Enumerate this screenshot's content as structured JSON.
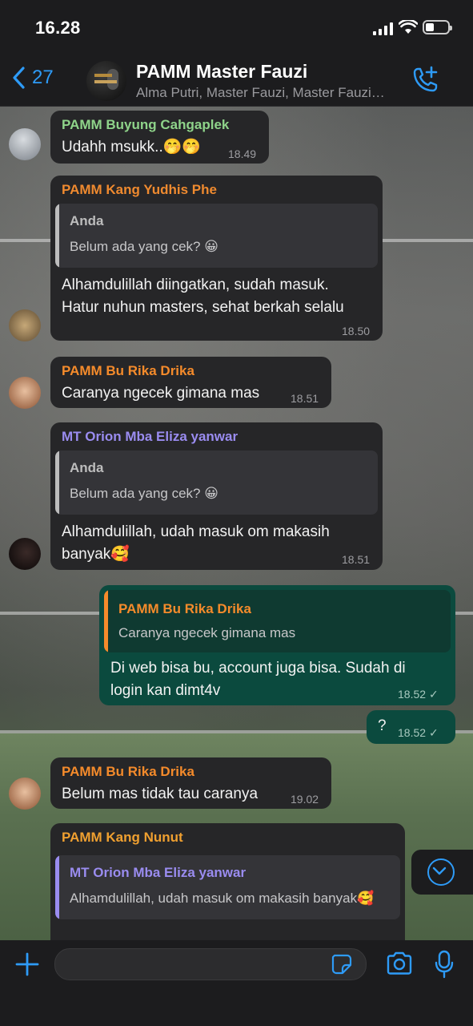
{
  "status_bar": {
    "time": "16.28"
  },
  "header": {
    "back_count": "27",
    "title": "PAMM Master Fauzi",
    "subtitle": "Alma Putri, Master Fauzi, Master Fauzi…"
  },
  "messages": [
    {
      "sender": "PAMM Buyung Cahgaplek",
      "sender_color": "#8fd48a",
      "lines": [
        "Udahh msukk..🤭🤭"
      ],
      "time": "18.49"
    },
    {
      "sender": "PAMM Kang Yudhis Phe",
      "sender_color": "#ef8a2f",
      "quote": {
        "name": "Anda",
        "text": "Belum ada yang cek? 😀",
        "color": "#bdbdbd"
      },
      "lines": [
        "Alhamdulillah diingatkan, sudah masuk.",
        "Hatur nuhun masters, sehat berkah selalu"
      ],
      "time": "18.50"
    },
    {
      "sender": "PAMM Bu Rika Drika",
      "sender_color": "#f58b2b",
      "lines": [
        "Caranya ngecek gimana mas"
      ],
      "time": "18.51"
    },
    {
      "sender": "MT Orion Mba Eliza yanwar",
      "sender_color": "#9a8cf0",
      "quote": {
        "name": "Anda",
        "text": "Belum ada yang cek? 😀",
        "color": "#bdbdbd"
      },
      "lines": [
        "Alhamdulillah, udah masuk om makasih",
        "banyak🥰"
      ],
      "time": "18.51"
    },
    {
      "outgoing": true,
      "quote": {
        "name": "PAMM Bu Rika Drika",
        "text": "Caranya ngecek gimana mas",
        "color": "#f58b2b"
      },
      "lines": [
        "Di web bisa bu, account juga bisa. Sudah di",
        "login kan dimt4v"
      ],
      "time": "18.52",
      "status": "✓"
    },
    {
      "outgoing": true,
      "lines": [
        "?"
      ],
      "time": "18.52",
      "status": "✓"
    },
    {
      "sender": "PAMM Bu Rika Drika",
      "sender_color": "#f58b2b",
      "lines": [
        "Belum mas tidak tau caranya"
      ],
      "time": "19.02"
    },
    {
      "sender": "PAMM Kang Nunut",
      "sender_color": "#f0a030",
      "quote": {
        "name": "MT Orion Mba Eliza yanwar",
        "text": "Alhamdulillah, udah masuk om makasih banyak🥰",
        "color": "#9a8cf0"
      },
      "lines": [],
      "time": ""
    }
  ],
  "icons": {
    "back": "chevron-left-icon",
    "call": "phone-plus-icon",
    "scroll": "chevron-down-icon",
    "attach": "plus-icon",
    "sticker": "sticker-icon",
    "camera": "camera-icon",
    "mic": "microphone-icon"
  },
  "colors": {
    "accent": "#2e9bf7",
    "incoming_bubble": "#262628",
    "outgoing_bubble": "#0b4a3e"
  }
}
